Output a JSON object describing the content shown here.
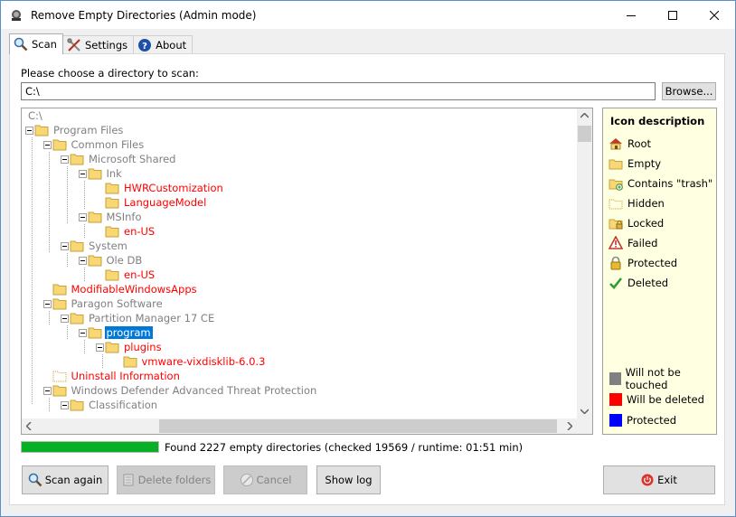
{
  "window": {
    "title": "Remove Empty Directories (Admin mode)"
  },
  "colors": {
    "red_text": "#ff0000",
    "grey_text": "#808080",
    "selection": "#0078d7",
    "progress": "#06b025",
    "legend_bg": "#ffffe1",
    "swatch_grey": "#808080",
    "swatch_red": "#ff0000",
    "swatch_blue": "#0000ff"
  },
  "tabs": [
    {
      "label": "Scan",
      "icon": "magnifier-icon"
    },
    {
      "label": "Settings",
      "icon": "tools-icon"
    },
    {
      "label": "About",
      "icon": "help-icon"
    }
  ],
  "scan": {
    "path_label": "Please choose a directory to scan:",
    "path_value": "C:\\",
    "browse_label": "Browse..."
  },
  "tree": {
    "items": [
      {
        "label": "C:\\",
        "style": "grey",
        "icon": "none"
      },
      {
        "label": "Program Files",
        "style": "grey",
        "icon": "folder"
      },
      {
        "label": "Common Files",
        "style": "grey",
        "icon": "folder"
      },
      {
        "label": "Microsoft Shared",
        "style": "grey",
        "icon": "folder"
      },
      {
        "label": "Ink",
        "style": "grey",
        "icon": "folder"
      },
      {
        "label": "HWRCustomization",
        "style": "red",
        "icon": "folder"
      },
      {
        "label": "LanguageModel",
        "style": "red",
        "icon": "folder"
      },
      {
        "label": "MSInfo",
        "style": "grey",
        "icon": "folder"
      },
      {
        "label": "en-US",
        "style": "red",
        "icon": "folder"
      },
      {
        "label": "System",
        "style": "grey",
        "icon": "folder"
      },
      {
        "label": "Ole DB",
        "style": "grey",
        "icon": "folder"
      },
      {
        "label": "en-US",
        "style": "red",
        "icon": "folder"
      },
      {
        "label": "ModifiableWindowsApps",
        "style": "red",
        "icon": "folder"
      },
      {
        "label": "Paragon Software",
        "style": "grey",
        "icon": "folder"
      },
      {
        "label": "Partition Manager 17 CE",
        "style": "grey",
        "icon": "folder"
      },
      {
        "label": "program",
        "style": "selected",
        "icon": "folder"
      },
      {
        "label": "plugins",
        "style": "red",
        "icon": "folder"
      },
      {
        "label": "vmware-vixdisklib-6.0.3",
        "style": "red",
        "icon": "folder"
      },
      {
        "label": "Uninstall Information",
        "style": "red",
        "icon": "hidden-folder"
      },
      {
        "label": "Windows Defender Advanced Threat Protection",
        "style": "grey",
        "icon": "folder"
      },
      {
        "label": "Classification",
        "style": "grey",
        "icon": "folder"
      }
    ]
  },
  "legend": {
    "title": "Icon description",
    "icons": [
      {
        "label": "Root",
        "icon": "root-icon"
      },
      {
        "label": "Empty",
        "icon": "empty-folder-icon"
      },
      {
        "label": "Contains \"trash\"",
        "icon": "trash-folder-icon"
      },
      {
        "label": "Hidden",
        "icon": "hidden-folder-icon"
      },
      {
        "label": "Locked",
        "icon": "locked-folder-icon"
      },
      {
        "label": "Failed",
        "icon": "warning-icon"
      },
      {
        "label": "Protected",
        "icon": "lock-icon"
      },
      {
        "label": "Deleted",
        "icon": "checkmark-icon"
      }
    ],
    "colors": [
      {
        "label": "Will not be touched",
        "color": "#808080"
      },
      {
        "label": "Will be deleted",
        "color": "#ff0000"
      },
      {
        "label": "Protected",
        "color": "#0000ff"
      }
    ]
  },
  "progress": {
    "fraction": 1.0
  },
  "status": {
    "text": "Found 2227 empty directories (checked 19569 / runtime: 01:51 min)"
  },
  "buttons": {
    "scan_again": "Scan again",
    "delete_folders": "Delete folders",
    "cancel": "Cancel",
    "show_log": "Show log",
    "exit": "Exit"
  }
}
